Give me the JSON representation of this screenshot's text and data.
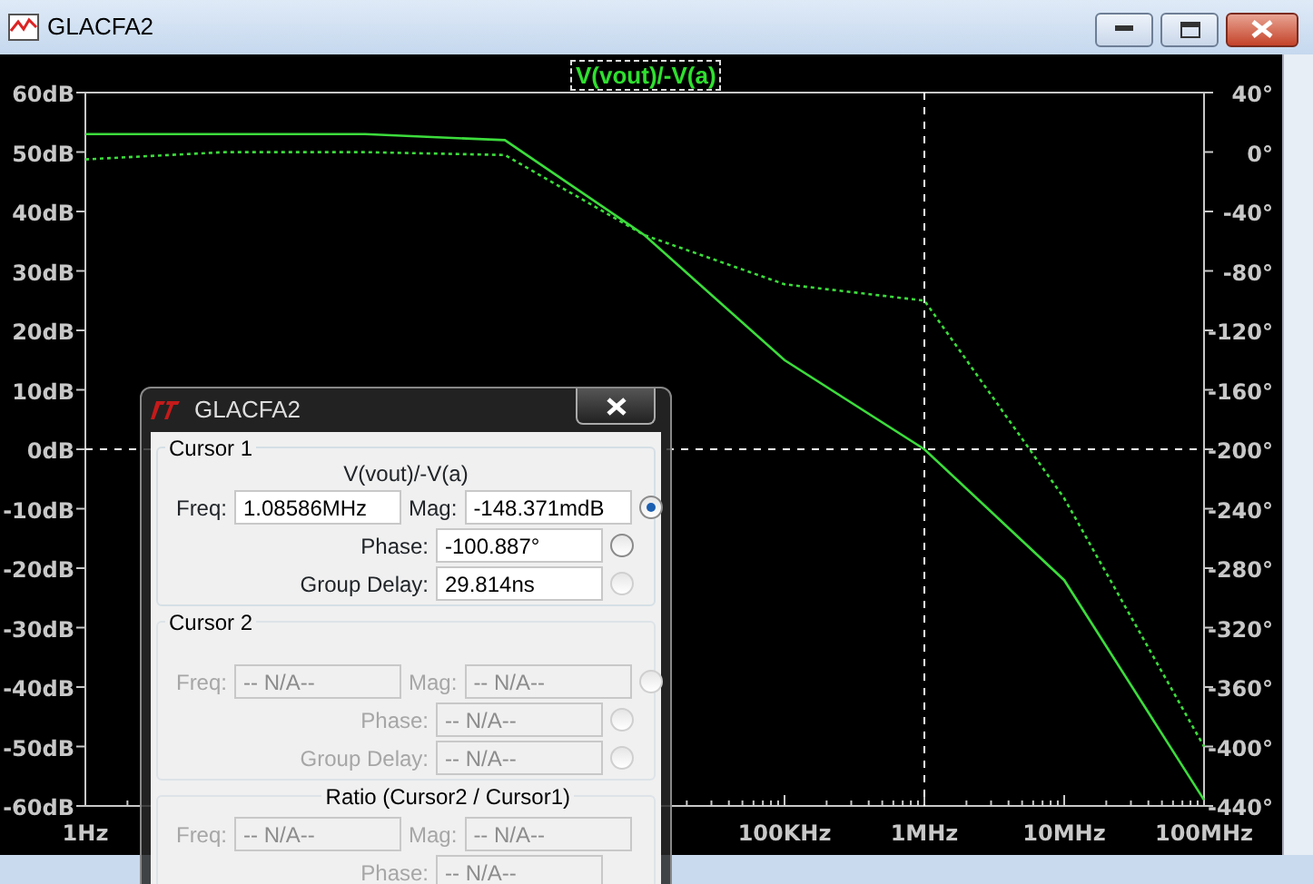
{
  "window": {
    "title": "GLACFA2"
  },
  "plot": {
    "trace_title": "V(vout)/-V(a)",
    "chart_data": {
      "type": "line",
      "categories": [
        "1Hz",
        null,
        null,
        null,
        null,
        "100KHz",
        "1MHz",
        "10MHz",
        "100MHz"
      ],
      "ylim": [
        -60,
        60
      ],
      "yticks": [
        {
          "value": 60,
          "label": "60dB"
        },
        {
          "value": 50,
          "label": "50dB"
        },
        {
          "value": 40,
          "label": "40dB"
        },
        {
          "value": 30,
          "label": "30dB"
        },
        {
          "value": 20,
          "label": "20dB"
        },
        {
          "value": 10,
          "label": "10dB"
        },
        {
          "value": 0,
          "label": "0dB"
        },
        {
          "value": -10,
          "label": "-10dB"
        },
        {
          "value": -20,
          "label": "-20dB"
        },
        {
          "value": -30,
          "label": "-30dB"
        },
        {
          "value": -40,
          "label": "-40dB"
        },
        {
          "value": -50,
          "label": "-50dB"
        },
        {
          "value": -60,
          "label": "-60dB"
        }
      ],
      "y2lim": [
        -440,
        40
      ],
      "y2ticks": [
        {
          "value": 40,
          "label": "40°"
        },
        {
          "value": 0,
          "label": "0°"
        },
        {
          "value": -40,
          "label": "-40°"
        },
        {
          "value": -80,
          "label": "-80°"
        },
        {
          "value": -120,
          "label": "-120°"
        },
        {
          "value": -160,
          "label": "-160°"
        },
        {
          "value": -200,
          "label": "-200°"
        },
        {
          "value": -240,
          "label": "-240°"
        },
        {
          "value": -280,
          "label": "-280°"
        },
        {
          "value": -320,
          "label": "-320°"
        },
        {
          "value": -360,
          "label": "-360°"
        },
        {
          "value": -400,
          "label": "-400°"
        },
        {
          "value": -440,
          "label": "-440°"
        }
      ],
      "series": [
        {
          "color": "#3cdc3c",
          "values": [
            53,
            53,
            53,
            52,
            36,
            15,
            0,
            -22,
            -59
          ]
        },
        {
          "color": "#3cdc3c",
          "axis": "y2",
          "line_style": "dashed",
          "values": [
            -5,
            0,
            0,
            -2,
            -56,
            -89,
            -100,
            -233,
            -400
          ]
        }
      ],
      "ref_lines": [
        {
          "axis": "x",
          "value": "1MHz"
        },
        {
          "axis": "y",
          "value": 0
        }
      ]
    }
  },
  "dialog": {
    "title": "GLACFA2",
    "groups": [
      {
        "title": "Cursor 1",
        "kind": "cursor",
        "disabled": false,
        "subtitle": "V(vout)/-V(a)",
        "freq": {
          "label": "Freq:",
          "value": "1.08586MHz"
        },
        "rows": [
          {
            "label": "Mag:",
            "value": "-148.371mdB",
            "radio": {
              "selected": true,
              "disabled": false
            }
          },
          {
            "label": "Phase:",
            "value": "-100.887°",
            "radio": {
              "selected": false,
              "disabled": false
            }
          },
          {
            "label": "Group Delay:",
            "value": "29.814ns",
            "radio": {
              "selected": false,
              "disabled": true
            }
          }
        ]
      },
      {
        "title": "Cursor 2",
        "kind": "cursor",
        "disabled": true,
        "freq": {
          "label": "Freq:",
          "value": "-- N/A--"
        },
        "rows": [
          {
            "label": "Mag:",
            "value": "-- N/A--",
            "radio": {
              "selected": false,
              "disabled": true
            }
          },
          {
            "label": "Phase:",
            "value": "-- N/A--",
            "radio": {
              "selected": false,
              "disabled": true
            }
          },
          {
            "label": "Group Delay:",
            "value": "-- N/A--",
            "radio": {
              "selected": false,
              "disabled": true
            }
          }
        ]
      },
      {
        "title": "Ratio (Cursor2 / Cursor1)",
        "kind": "ratio",
        "disabled": true,
        "freq": {
          "label": "Freq:",
          "value": "-- N/A--"
        },
        "rows": [
          {
            "label": "Mag:",
            "value": "-- N/A--"
          },
          {
            "label": "Phase:",
            "value": "-- N/A--"
          }
        ]
      }
    ]
  }
}
